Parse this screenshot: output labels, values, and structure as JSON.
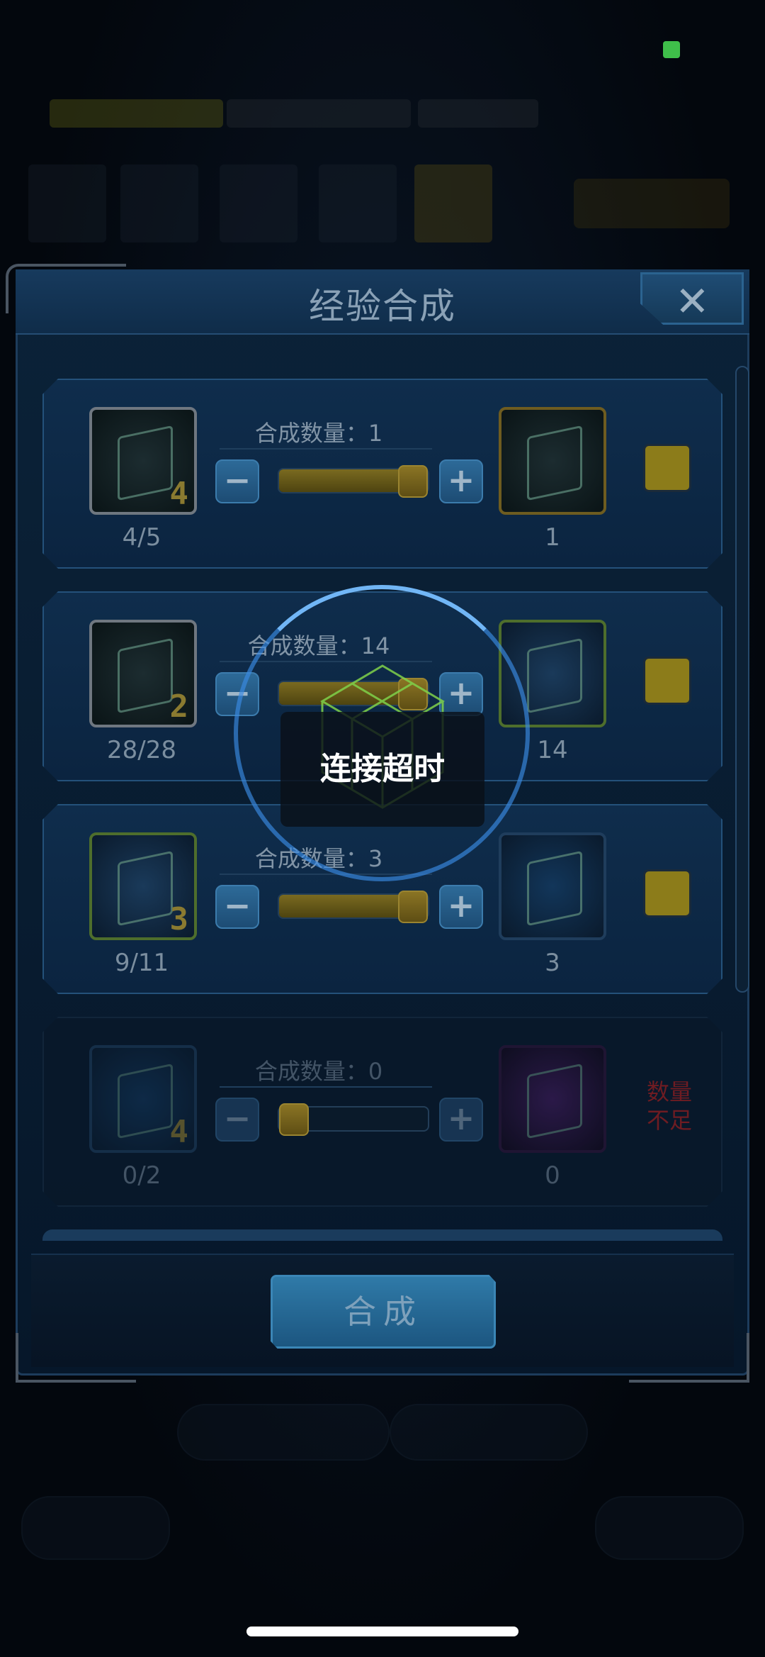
{
  "window": {
    "title": "经验合成"
  },
  "close_button": {
    "label": "✕"
  },
  "rows": [
    {
      "qty_label": "合成数量：1",
      "src_level": "4",
      "src_count": "4/5",
      "dst_count": "1",
      "src_style": "plain",
      "dst_style": "gold",
      "slider_fraction": 1.0,
      "enabled": true
    },
    {
      "qty_label": "合成数量：14",
      "src_level": "2",
      "src_count": "28/28",
      "dst_count": "14",
      "src_style": "plain",
      "dst_style": "green",
      "slider_fraction": 1.0,
      "enabled": true
    },
    {
      "qty_label": "合成数量：3",
      "src_level": "3",
      "src_count": "9/11",
      "dst_count": "3",
      "src_style": "green",
      "dst_style": "blue",
      "slider_fraction": 1.0,
      "enabled": true
    },
    {
      "qty_label": "合成数量：0",
      "src_level": "4",
      "src_count": "0/2",
      "dst_count": "0",
      "src_style": "blue",
      "dst_style": "purple",
      "slider_fraction": 0.0,
      "enabled": false,
      "status": "数量不足"
    }
  ],
  "controls": {
    "minus": "−",
    "plus": "+"
  },
  "compose_button": {
    "label": "合成"
  },
  "loading": {
    "message": "连接超时"
  },
  "colors": {
    "accent": "#3c8ce6",
    "checkbox": "#8c7c1a",
    "warning": "#6e1c22"
  }
}
